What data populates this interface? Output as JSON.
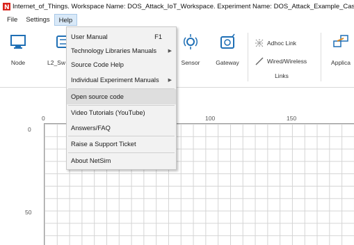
{
  "window": {
    "title": "Internet_of_Things. Workspace Name: DOS_Attack_IoT_Workspace. Experiment Name: DOS_Attack_Example_Cas"
  },
  "menubar": {
    "items": [
      {
        "label": "File"
      },
      {
        "label": "Settings"
      },
      {
        "label": "Help"
      }
    ]
  },
  "ribbon": {
    "tools": [
      {
        "label": "Node",
        "icon": "monitor-icon"
      },
      {
        "label": "L2_Sw",
        "icon": "switch-icon"
      },
      {
        "label": "Sensor",
        "icon": "sensor-icon"
      },
      {
        "label": "Gateway",
        "icon": "gateway-icon"
      },
      {
        "label": "Links",
        "icon": "links-icon"
      },
      {
        "label": "Applica",
        "icon": "application-icon"
      }
    ],
    "links": {
      "adhoc": "Adhoc Link",
      "wired": "Wired/Wireless"
    }
  },
  "help_menu": {
    "items": [
      {
        "label": "User Manual",
        "shortcut": "F1",
        "submenu": false
      },
      {
        "label": "Technology Libraries Manuals",
        "submenu": true
      },
      {
        "label": "Source Code Help",
        "submenu": false
      },
      {
        "label": "Individual Experiment Manuals",
        "submenu": true
      },
      {
        "label": "Open source code",
        "submenu": false,
        "highlighted": true
      },
      {
        "label": "Video Tutorials (YouTube)",
        "submenu": false
      },
      {
        "label": "Answers/FAQ",
        "submenu": false
      },
      {
        "label": "Raise a Support Ticket",
        "submenu": false
      },
      {
        "label": "About NetSim",
        "submenu": false
      }
    ]
  },
  "canvas": {
    "ruler_x": [
      "0",
      "100",
      "150"
    ],
    "ruler_y": [
      "0",
      "50"
    ]
  },
  "colors": {
    "menu_active_bg": "#d9e9f8",
    "dropdown_bg": "#f2f2f2",
    "dropdown_hover": "#dedede",
    "accent_blue": "#1f6fb5",
    "app_icon_red": "#d9241c"
  }
}
